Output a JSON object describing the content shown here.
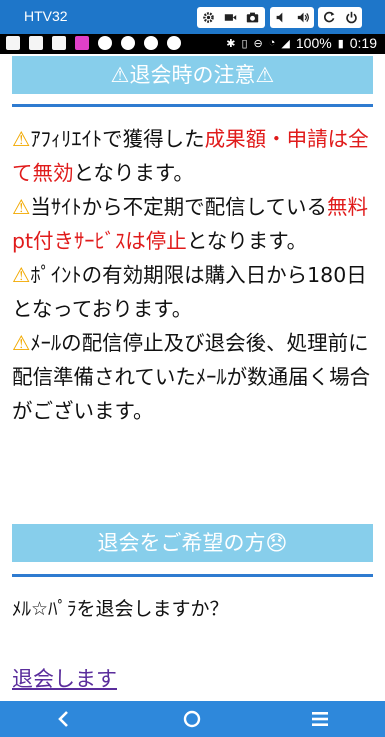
{
  "emulator": {
    "title": "HTV32"
  },
  "status_bar": {
    "battery": "100%",
    "time": "0:19"
  },
  "notice": {
    "header": "⚠退会時の注意⚠",
    "items": [
      {
        "warn_icon": "⚠",
        "segments": [
          {
            "text": "ｱﾌｨﾘｴｲﾄで獲得した",
            "red": false
          },
          {
            "text": "成果額・申請は全て無効",
            "red": true
          },
          {
            "text": "となります。",
            "red": false
          }
        ]
      },
      {
        "warn_icon": "⚠",
        "segments": [
          {
            "text": "当ｻｲﾄから不定期で配信している",
            "red": false
          },
          {
            "text": "無料pt付きｻｰﾋﾞｽは停止",
            "red": true
          },
          {
            "text": "となります。",
            "red": false
          }
        ]
      },
      {
        "warn_icon": "⚠",
        "segments": [
          {
            "text": "ﾎﾟｲﾝﾄの有効期限は購入日から180日となっております。",
            "red": false
          }
        ]
      },
      {
        "warn_icon": "⚠",
        "segments": [
          {
            "text": "ﾒｰﾙの配信停止及び退会後、処理前に配信準備されていたﾒｰﾙが数通届く場合がございます。",
            "red": false
          }
        ]
      }
    ]
  },
  "confirm": {
    "header": "退会をご希望の方😞",
    "question": "ﾒﾙ☆ﾊﾟﾗを退会しますか？",
    "link": "退会します"
  },
  "colors": {
    "header_bg": "#87ceeb",
    "rule": "#2e7bd0",
    "emphasis": "#e01b1b",
    "link": "#5a2d9c",
    "nav_bar": "#2e88db",
    "emu_bar": "#1e76c9"
  },
  "icons": {
    "emulator_controls": [
      "gear-icon",
      "video-camera-icon",
      "camera-icon",
      "volume-down-icon",
      "volume-up-icon",
      "rotate-icon",
      "power-icon"
    ],
    "nav": [
      "back-icon",
      "home-icon",
      "menu-icon"
    ]
  }
}
